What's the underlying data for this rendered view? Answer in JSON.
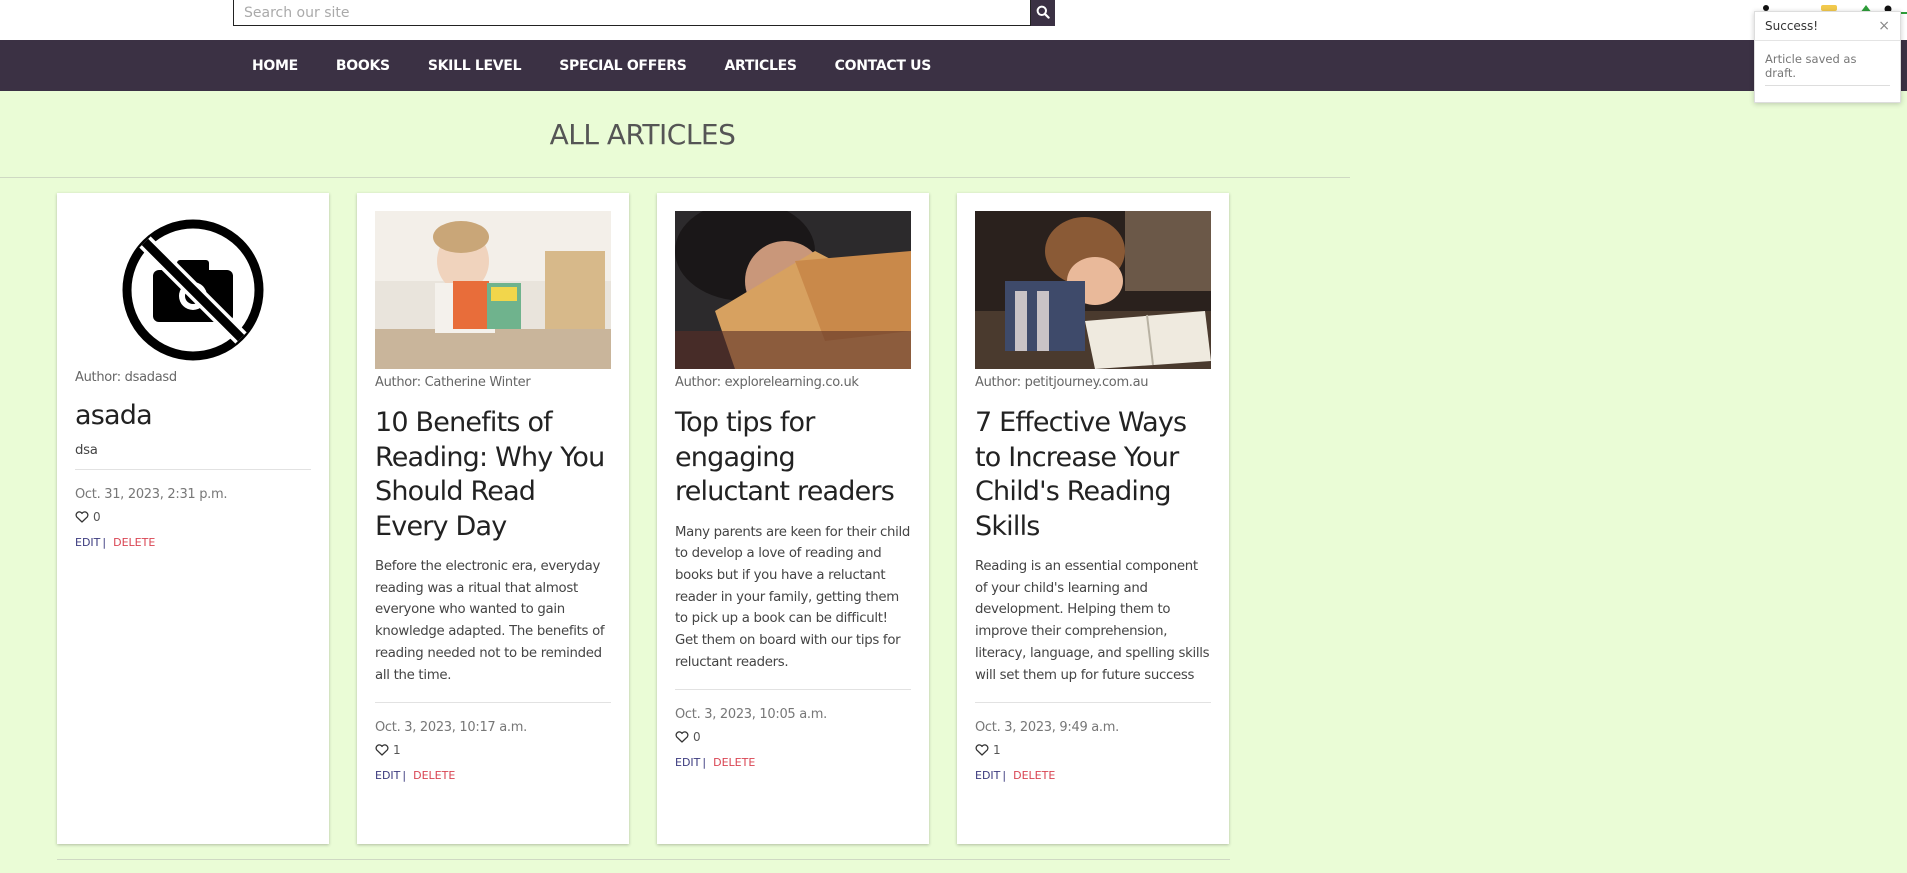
{
  "search": {
    "placeholder": "Search our site"
  },
  "nav": {
    "items": [
      {
        "label": "HOME"
      },
      {
        "label": "BOOKS"
      },
      {
        "label": "SKILL LEVEL"
      },
      {
        "label": "SPECIAL OFFERS"
      },
      {
        "label": "ARTICLES"
      },
      {
        "label": "CONTACT US"
      }
    ]
  },
  "page": {
    "title": "ALL ARTICLES"
  },
  "toast": {
    "title": "Success!",
    "close": "×",
    "message": "Article saved as draft."
  },
  "colors": {
    "nav_bg": "#3b3144",
    "page_bg": "#eafcd6",
    "edit": "#3b3a7e",
    "delete": "#d94452"
  },
  "articles": [
    {
      "image": "no-image-icon",
      "author": "Author: dsadasd",
      "title": "asada",
      "excerpt": "dsa",
      "date": "Oct. 31, 2023, 2:31 p.m.",
      "likes": "0",
      "edit": "EDIT",
      "sep": "|",
      "delete": "DELETE"
    },
    {
      "image": "girl-reading-photo",
      "author": "Author: Catherine Winter",
      "title": "10 Benefits of Reading: Why You Should Read Every Day",
      "excerpt": "Before the electronic era, everyday reading was a ritual that almost everyone who wanted to gain knowledge adapted. The benefits of reading needed not to be reminded all the time.",
      "date": "Oct. 3, 2023, 10:17 a.m.",
      "likes": "1",
      "edit": "EDIT",
      "sep": "|",
      "delete": "DELETE"
    },
    {
      "image": "boy-reading-book-photo",
      "author": "Author: explorelearning.co.uk",
      "title": "Top tips for engaging reluctant readers",
      "excerpt": "Many parents are keen for their child to develop a love of reading and books but if you have a reluctant reader in your family, getting them to pick up a book can be difficult! Get them on board with our tips for reluctant readers.",
      "date": "Oct. 3, 2023, 10:05 a.m.",
      "likes": "0",
      "edit": "EDIT",
      "sep": "|",
      "delete": "DELETE"
    },
    {
      "image": "child-reading-table-photo",
      "author": "Author: petitjourney.com.au",
      "title": "7 Effective Ways to Increase Your Child's Reading Skills",
      "excerpt": "Reading is an essential component of your child's learning and development. Helping them to improve their comprehension, literacy, language, and spelling skills will set them up for future success",
      "date": "Oct. 3, 2023, 9:49 a.m.",
      "likes": "1",
      "edit": "EDIT",
      "sep": "|",
      "delete": "DELETE"
    }
  ]
}
